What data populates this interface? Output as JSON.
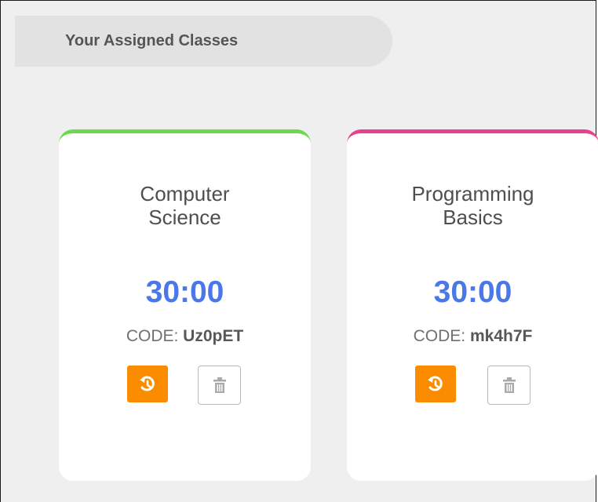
{
  "header": {
    "title": "Your Assigned Classes"
  },
  "classes": [
    {
      "title_lines": [
        "Computer",
        "Science"
      ],
      "timer": "30:00",
      "code_label": "CODE:",
      "code": "Uz0pET",
      "accent_color": "#6cd94d",
      "restart_icon": "restart-timer-icon",
      "delete_icon": "trash-icon"
    },
    {
      "title_lines": [
        "Programming",
        "Basics"
      ],
      "timer": "30:00",
      "code_label": "CODE:",
      "code": "mk4h7F",
      "accent_color": "#e8428e",
      "restart_icon": "restart-timer-icon",
      "delete_icon": "trash-icon"
    }
  ],
  "colors": {
    "timer": "#4a78e8",
    "restart_button": "#fb8c00",
    "background": "#efefef"
  }
}
